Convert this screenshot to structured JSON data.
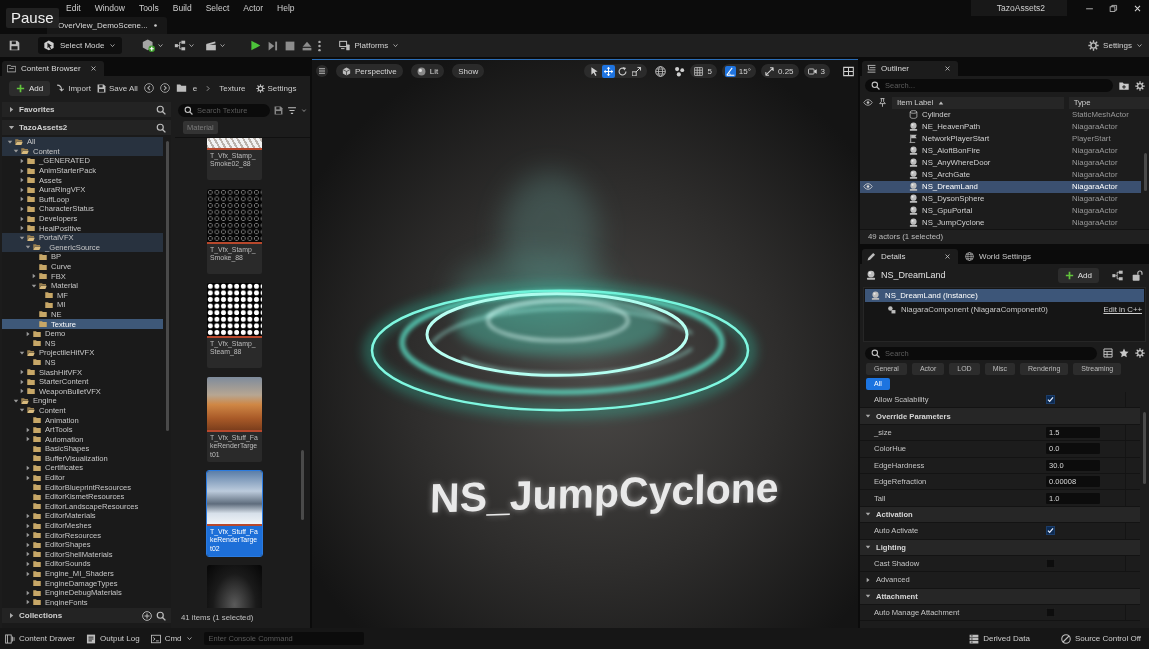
{
  "overlay": {
    "label": "Pause"
  },
  "menu": [
    "Edit",
    "Window",
    "Tools",
    "Build",
    "Select",
    "Actor",
    "Help"
  ],
  "project": "TazoAssets2",
  "level_tab": {
    "label": "OverView_DemoScene...",
    "modified": true
  },
  "toolbar": {
    "mode": "Select Mode",
    "platforms": "Platforms",
    "settings": "Settings"
  },
  "content_browser": {
    "tab": "Content Browser",
    "add": "Add",
    "import": "Import",
    "save_all": "Save All",
    "breadcrumbs": [
      "e",
      "Texture"
    ],
    "settings": "Settings",
    "favorites": {
      "label": "Favorites",
      "expanded": false
    },
    "root": {
      "label": "TazoAssets2",
      "expanded": true
    },
    "tree": [
      {
        "label": "All",
        "expandable": true,
        "expanded": true,
        "selected": false,
        "children": [
          {
            "label": "Content",
            "expandable": true,
            "expanded": true,
            "selected": false,
            "children": [
              {
                "label": "_GENERATED",
                "expandable": true,
                "expanded": false,
                "selected": false
              },
              {
                "label": "AnimStarterPack",
                "expandable": true,
                "expanded": false,
                "selected": false
              },
              {
                "label": "Assets",
                "expandable": true,
                "expanded": false,
                "selected": false
              },
              {
                "label": "AuraRingVFX",
                "expandable": true,
                "expanded": false,
                "selected": false
              },
              {
                "label": "BuffLoop",
                "expandable": true,
                "expanded": false,
                "selected": false
              },
              {
                "label": "CharacterStatus",
                "expandable": true,
                "expanded": false,
                "selected": false
              },
              {
                "label": "Developers",
                "expandable": true,
                "expanded": false,
                "selected": false
              },
              {
                "label": "HealPositive",
                "expandable": true,
                "expanded": false,
                "selected": false
              },
              {
                "label": "PortalVFX",
                "expandable": true,
                "expanded": true,
                "selected": false,
                "children": [
                  {
                    "label": "_GenericSource",
                    "expandable": true,
                    "expanded": true,
                    "selected": false,
                    "children": [
                      {
                        "label": "BP",
                        "expandable": false,
                        "expanded": false,
                        "selected": false
                      },
                      {
                        "label": "Curve",
                        "expandable": false,
                        "expanded": false,
                        "selected": false
                      },
                      {
                        "label": "FBX",
                        "expandable": true,
                        "expanded": false,
                        "selected": false
                      },
                      {
                        "label": "Material",
                        "expandable": true,
                        "expanded": true,
                        "selected": false,
                        "children": [
                          {
                            "label": "MF",
                            "expandable": false,
                            "expanded": false,
                            "selected": false
                          },
                          {
                            "label": "MI",
                            "expandable": false,
                            "expanded": false,
                            "selected": false
                          }
                        ]
                      },
                      {
                        "label": "NE",
                        "expandable": false,
                        "expanded": false,
                        "selected": false
                      },
                      {
                        "label": "Texture",
                        "expandable": false,
                        "expanded": false,
                        "selected": true
                      }
                    ]
                  },
                  {
                    "label": "Demo",
                    "expandable": true,
                    "expanded": false,
                    "selected": false
                  },
                  {
                    "label": "NS",
                    "expandable": false,
                    "expanded": false,
                    "selected": false
                  }
                ]
              },
              {
                "label": "ProjectileHitVFX",
                "expandable": true,
                "expanded": true,
                "selected": false,
                "children": [
                  {
                    "label": "NS",
                    "expandable": false,
                    "expanded": false,
                    "selected": false
                  }
                ]
              },
              {
                "label": "SlashHitVFX",
                "expandable": true,
                "expanded": false,
                "selected": false
              },
              {
                "label": "StarterContent",
                "expandable": true,
                "expanded": false,
                "selected": false
              },
              {
                "label": "WeaponBulletVFX",
                "expandable": true,
                "expanded": false,
                "selected": false
              }
            ]
          },
          {
            "label": "Engine",
            "expandable": true,
            "expanded": true,
            "selected": false,
            "children": [
              {
                "label": "Content",
                "expandable": true,
                "expanded": true,
                "selected": false,
                "children": [
                  {
                    "label": "Animation",
                    "expandable": false,
                    "expanded": false,
                    "selected": false
                  },
                  {
                    "label": "ArtTools",
                    "expandable": true,
                    "expanded": false,
                    "selected": false
                  },
                  {
                    "label": "Automation",
                    "expandable": true,
                    "expanded": false,
                    "selected": false
                  },
                  {
                    "label": "BasicShapes",
                    "expandable": false,
                    "expanded": false,
                    "selected": false
                  },
                  {
                    "label": "BufferVisualization",
                    "expandable": false,
                    "expanded": false,
                    "selected": false
                  },
                  {
                    "label": "Certificates",
                    "expandable": true,
                    "expanded": false,
                    "selected": false
                  },
                  {
                    "label": "Editor",
                    "expandable": true,
                    "expanded": false,
                    "selected": false
                  },
                  {
                    "label": "EditorBlueprintResources",
                    "expandable": false,
                    "expanded": false,
                    "selected": false
                  },
                  {
                    "label": "EditorKismetResources",
                    "expandable": false,
                    "expanded": false,
                    "selected": false
                  },
                  {
                    "label": "EditorLandscapeResources",
                    "expandable": false,
                    "expanded": false,
                    "selected": false
                  },
                  {
                    "label": "EditorMaterials",
                    "expandable": true,
                    "expanded": false,
                    "selected": false
                  },
                  {
                    "label": "EditorMeshes",
                    "expandable": true,
                    "expanded": false,
                    "selected": false
                  },
                  {
                    "label": "EditorResources",
                    "expandable": true,
                    "expanded": false,
                    "selected": false
                  },
                  {
                    "label": "EditorShapes",
                    "expandable": true,
                    "expanded": false,
                    "selected": false
                  },
                  {
                    "label": "EditorShellMaterials",
                    "expandable": true,
                    "expanded": false,
                    "selected": false
                  },
                  {
                    "label": "EditorSounds",
                    "expandable": true,
                    "expanded": false,
                    "selected": false
                  },
                  {
                    "label": "Engine_MI_Shaders",
                    "expandable": true,
                    "expanded": false,
                    "selected": false
                  },
                  {
                    "label": "EngineDamageTypes",
                    "expandable": false,
                    "expanded": false,
                    "selected": false
                  },
                  {
                    "label": "EngineDebugMaterials",
                    "expandable": true,
                    "expanded": false,
                    "selected": false
                  },
                  {
                    "label": "EngineFonts",
                    "expandable": true,
                    "expanded": false,
                    "selected": false
                  }
                ]
              }
            ]
          }
        ]
      }
    ],
    "collections": {
      "label": "Collections",
      "expanded": false
    },
    "search": {
      "placeholder": "Search Texture"
    },
    "filters": [
      "Material"
    ],
    "assets": [
      {
        "label": "T_Vfx_Stamp_Smoke02_88",
        "kind": "stripes",
        "selected": false
      },
      {
        "label": "T_Vfx_Stamp_Smoke_88",
        "kind": "rings",
        "selected": false
      },
      {
        "label": "T_Vfx_Stamp_Steam_88",
        "kind": "blobs",
        "selected": false
      },
      {
        "label": "T_Vfx_Stuff_FakeRenderTarget01",
        "kind": "desert",
        "selected": false
      },
      {
        "label": "T_Vfx_Stuff_FakeRenderTarget02",
        "kind": "mountains",
        "selected": true
      },
      {
        "kind": "smoke",
        "selected": false
      }
    ],
    "status": "41 items (1 selected)"
  },
  "viewport": {
    "view": "Perspective",
    "lighting": "Lit",
    "show": "Show",
    "tools": [
      {
        "kind": "select",
        "selected": false
      },
      {
        "kind": "move",
        "selected": true
      },
      {
        "kind": "rotate",
        "selected": false
      },
      {
        "kind": "scale",
        "selected": false
      }
    ],
    "snaps": [
      {
        "kind": "grid",
        "on": false,
        "value": "5"
      },
      {
        "kind": "angle",
        "on": true,
        "value": "15°"
      },
      {
        "kind": "scale",
        "on": false,
        "value": "0.25"
      }
    ],
    "camera_speed": "3",
    "scene_text": "NS_JumpCyclone"
  },
  "outliner": {
    "tab": "Outliner",
    "search": {
      "placeholder": "Search..."
    },
    "columns": [
      "Item Label",
      "Type"
    ],
    "rows": [
      {
        "label": "Cylinder",
        "type": "StaticMeshActor",
        "kind": "mesh",
        "selected": false
      },
      {
        "label": "NE_HeavenPath",
        "type": "NiagaraActor",
        "kind": "niagara",
        "selected": false
      },
      {
        "label": "NetworkPlayerStart",
        "type": "PlayerStart",
        "kind": "player-start",
        "selected": false
      },
      {
        "label": "NS_AloftBonFire",
        "type": "NiagaraActor",
        "kind": "niagara",
        "selected": false
      },
      {
        "label": "NS_AnyWhereDoor",
        "type": "NiagaraActor",
        "kind": "niagara",
        "selected": false
      },
      {
        "label": "NS_ArchGate",
        "type": "NiagaraActor",
        "kind": "niagara",
        "selected": false
      },
      {
        "label": "NS_DreamLand",
        "type": "NiagaraActor",
        "kind": "niagara",
        "selected": true
      },
      {
        "label": "NS_DysonSphere",
        "type": "NiagaraActor",
        "kind": "niagara",
        "selected": false
      },
      {
        "label": "NS_GpuPortal",
        "type": "NiagaraActor",
        "kind": "niagara",
        "selected": false
      },
      {
        "label": "NS_JumpCyclone",
        "type": "NiagaraActor",
        "kind": "niagara",
        "selected": false
      }
    ],
    "status": "49 actors (1 selected)"
  },
  "details": {
    "tab": "Details",
    "world_settings": "World Settings",
    "actor": "NS_DreamLand",
    "add": "Add",
    "components": [
      {
        "label": "NS_DreamLand (Instance)",
        "selected": true,
        "children": [
          {
            "label": "NiagaraComponent (NiagaraComponent0)",
            "selected": false
          }
        ]
      }
    ],
    "edit_link": "Edit in C++",
    "search": {
      "placeholder": "Search"
    },
    "categories": [
      {
        "label": "General",
        "selected": false
      },
      {
        "label": "Actor",
        "selected": false
      },
      {
        "label": "LOD",
        "selected": false
      },
      {
        "label": "Misc",
        "selected": false
      },
      {
        "label": "Rendering",
        "selected": false
      },
      {
        "label": "Streaming",
        "selected": false
      },
      {
        "label": "All",
        "selected": true
      }
    ],
    "properties": [
      {
        "kind": "checkbox",
        "label": "Allow Scalability",
        "checked": true
      },
      {
        "kind": "section",
        "label": "Override Parameters",
        "expanded": true,
        "children": [
          {
            "kind": "number",
            "label": "_size",
            "value": "1.5"
          },
          {
            "kind": "number",
            "label": "ColorHue",
            "value": "0.0"
          },
          {
            "kind": "number",
            "label": "EdgeHardness",
            "value": "30.0"
          },
          {
            "kind": "number",
            "label": "EdgeRefraction",
            "value": "0.00008"
          },
          {
            "kind": "number",
            "label": "Tall",
            "value": "1.0"
          }
        ]
      },
      {
        "kind": "section",
        "label": "Activation",
        "expanded": true,
        "children": [
          {
            "kind": "checkbox",
            "label": "Auto Activate",
            "checked": true
          }
        ]
      },
      {
        "kind": "section",
        "label": "Lighting",
        "expanded": true,
        "children": [
          {
            "kind": "checkbox",
            "label": "Cast Shadow",
            "checked": false
          },
          {
            "kind": "group",
            "label": "Advanced",
            "expanded": false
          }
        ]
      },
      {
        "kind": "section",
        "label": "Attachment",
        "expanded": true,
        "children": [
          {
            "kind": "checkbox",
            "label": "Auto Manage Attachment",
            "checked": false
          }
        ]
      }
    ]
  },
  "status_bar": {
    "content_drawer": "Content Drawer",
    "output_log": "Output Log",
    "cmd": "Cmd",
    "console": {
      "placeholder": "Enter Console Command"
    },
    "derived_data": "Derived Data",
    "source_control": "Source Control Off"
  }
}
